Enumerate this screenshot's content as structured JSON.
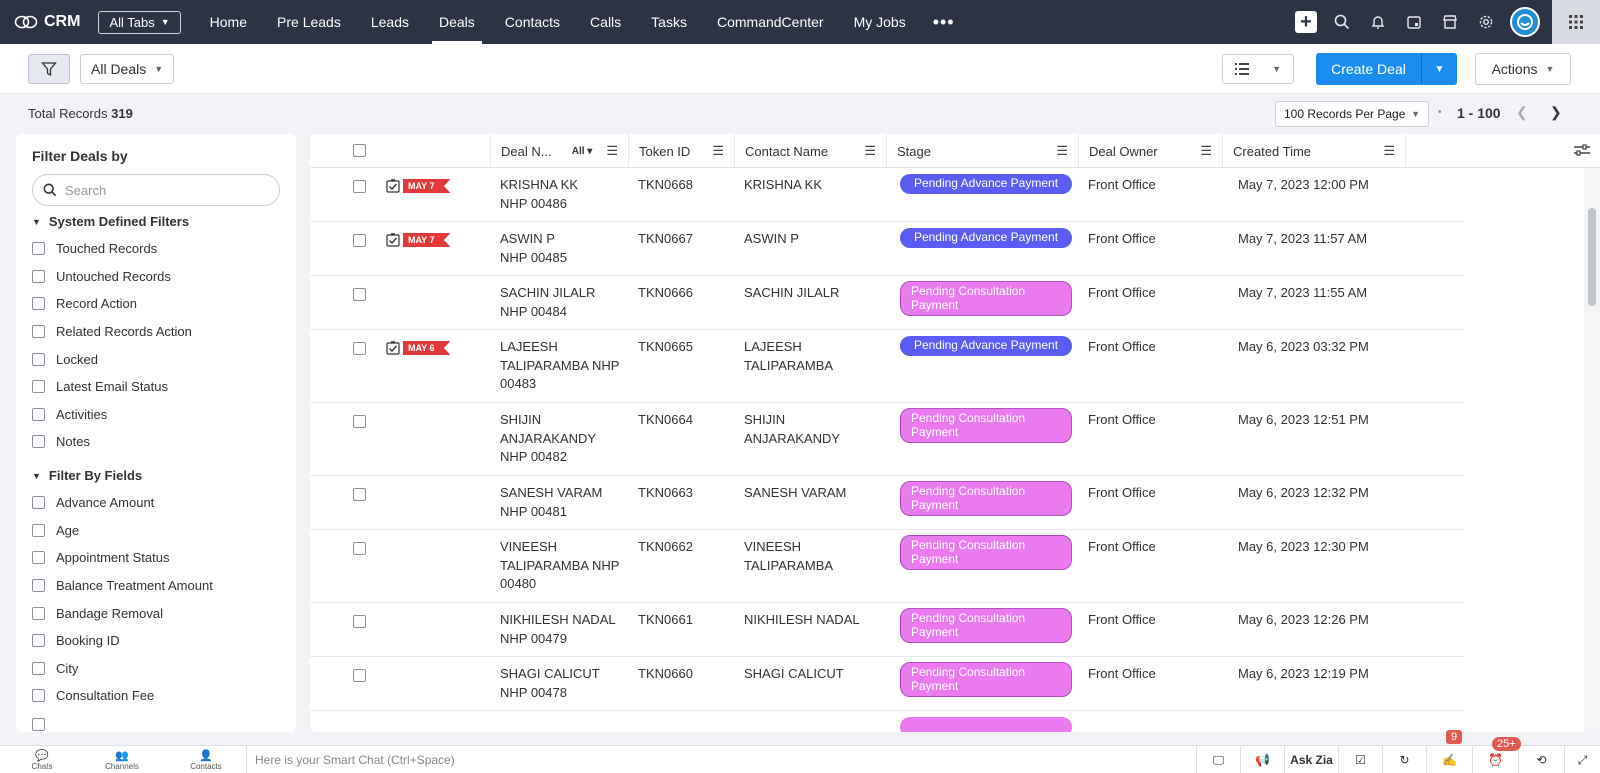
{
  "nav": {
    "brand": "CRM",
    "all_tabs": "All Tabs",
    "items": [
      "Home",
      "Pre Leads",
      "Leads",
      "Deals",
      "Contacts",
      "Calls",
      "Tasks",
      "CommandCenter",
      "My Jobs"
    ],
    "active": "Deals"
  },
  "toolbar": {
    "view": "All Deals",
    "create": "Create Deal",
    "actions": "Actions"
  },
  "records": {
    "total_label": "Total Records",
    "total": "319",
    "per_page": "100 Records Per Page",
    "range": "1 - 100"
  },
  "sidebar": {
    "title": "Filter Deals by",
    "search_placeholder": "Search",
    "system_title": "System Defined Filters",
    "system_filters": [
      "Touched Records",
      "Untouched Records",
      "Record Action",
      "Related Records Action",
      "Locked",
      "Latest Email Status",
      "Activities",
      "Notes"
    ],
    "fields_title": "Filter By Fields",
    "field_filters": [
      "Advance Amount",
      "Age",
      "Appointment Status",
      "Balance Treatment Amount",
      "Bandage Removal",
      "Booking ID",
      "City",
      "Consultation Fee"
    ]
  },
  "table": {
    "columns": {
      "deal": "Deal N...",
      "deal_filter": "All",
      "token": "Token ID",
      "contact": "Contact Name",
      "stage": "Stage",
      "owner": "Deal Owner",
      "created": "Created Time"
    },
    "rows": [
      {
        "tag": "MAY 7",
        "deal": [
          "KRISHNA KK",
          "NHP 00486"
        ],
        "token": "TKN0668",
        "contact": [
          "KRISHNA KK"
        ],
        "stage": "Pending Advance Payment",
        "stage_type": "adv",
        "owner": "Front Office",
        "created": "May 7, 2023 12:00 PM"
      },
      {
        "tag": "MAY 7",
        "deal": [
          "ASWIN P",
          "NHP 00485"
        ],
        "token": "TKN0667",
        "contact": [
          "ASWIN P"
        ],
        "stage": "Pending Advance Payment",
        "stage_type": "adv",
        "owner": "Front Office",
        "created": "May 7, 2023 11:57 AM"
      },
      {
        "tag": "",
        "deal": [
          "SACHIN JILALR",
          "NHP 00484"
        ],
        "token": "TKN0666",
        "contact": [
          "SACHIN JILALR"
        ],
        "stage": "Pending Consultation Payment",
        "stage_type": "cons",
        "owner": "Front Office",
        "created": "May 7, 2023 11:55 AM"
      },
      {
        "tag": "MAY 6",
        "deal": [
          "LAJEESH",
          "TALIPARAMBA NHP",
          "00483"
        ],
        "token": "TKN0665",
        "contact": [
          "LAJEESH",
          "TALIPARAMBA"
        ],
        "stage": "Pending Advance Payment",
        "stage_type": "adv",
        "owner": "Front Office",
        "created": "May 6, 2023 03:32 PM"
      },
      {
        "tag": "",
        "deal": [
          "SHIJIN",
          "ANJARAKANDY",
          "NHP 00482"
        ],
        "token": "TKN0664",
        "contact": [
          "SHIJIN",
          "ANJARAKANDY"
        ],
        "stage": "Pending Consultation Payment",
        "stage_type": "cons",
        "owner": "Front Office",
        "created": "May 6, 2023 12:51 PM"
      },
      {
        "tag": "",
        "deal": [
          "SANESH VARAM",
          "NHP 00481"
        ],
        "token": "TKN0663",
        "contact": [
          "SANESH VARAM"
        ],
        "stage": "Pending Consultation Payment",
        "stage_type": "cons",
        "owner": "Front Office",
        "created": "May 6, 2023 12:32 PM"
      },
      {
        "tag": "",
        "deal": [
          "VINEESH",
          "TALIPARAMBA NHP",
          "00480"
        ],
        "token": "TKN0662",
        "contact": [
          "VINEESH",
          "TALIPARAMBA"
        ],
        "stage": "Pending Consultation Payment",
        "stage_type": "cons",
        "owner": "Front Office",
        "created": "May 6, 2023 12:30 PM"
      },
      {
        "tag": "",
        "deal": [
          "NIKHILESH NADAL",
          "NHP 00479"
        ],
        "token": "TKN0661",
        "contact": [
          "NIKHILESH NADAL"
        ],
        "stage": "Pending Consultation Payment",
        "stage_type": "cons",
        "owner": "Front Office",
        "created": "May 6, 2023 12:26 PM"
      },
      {
        "tag": "",
        "deal": [
          "SHAGI CALICUT",
          "NHP 00478"
        ],
        "token": "TKN0660",
        "contact": [
          "SHAGI CALICUT"
        ],
        "stage": "Pending Consultation Payment",
        "stage_type": "cons",
        "owner": "Front Office",
        "created": "May 6, 2023 12:19 PM"
      }
    ]
  },
  "bottom": {
    "chats": "Chats",
    "channels": "Channels",
    "contacts": "Contacts",
    "smart_chat": "Here is your Smart Chat (Ctrl+Space)",
    "ask_zia": "Ask Zia",
    "badge_notes": "9",
    "badge_reminders": "25+"
  },
  "colors": {
    "nav_bg": "#2c3345",
    "primary": "#1a8cf0",
    "stage_advance": "#5b5cf3",
    "stage_consultation": "#e97af0",
    "tag_red": "#e23a3a"
  }
}
